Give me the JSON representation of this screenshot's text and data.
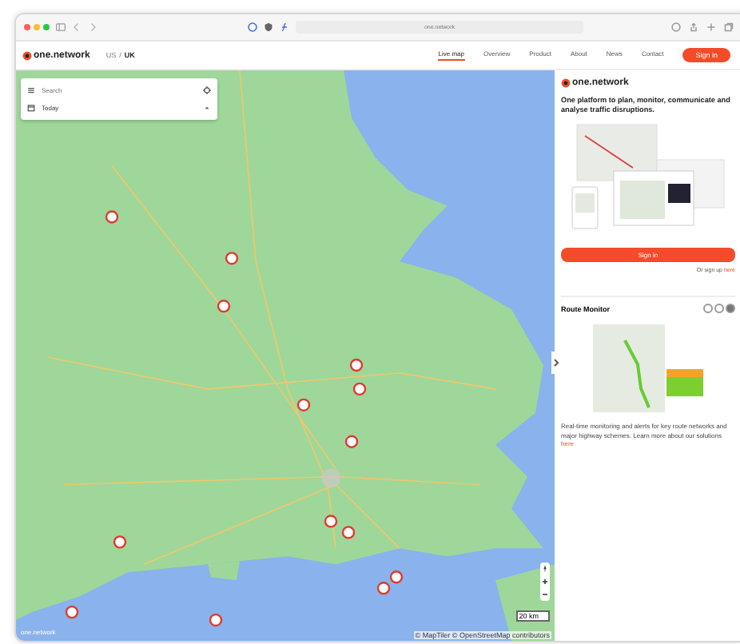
{
  "browser": {
    "url": "one.network"
  },
  "site": {
    "logo": "one.network",
    "region": {
      "options": [
        {
          "label": "US",
          "selected": false
        },
        {
          "label": "UK",
          "selected": true
        }
      ],
      "separator": "/"
    },
    "nav": [
      {
        "label": "Live map",
        "selected": true
      },
      {
        "label": "Overview",
        "selected": false
      },
      {
        "label": "Product",
        "selected": false
      },
      {
        "label": "About",
        "selected": false
      },
      {
        "label": "News",
        "selected": false
      },
      {
        "label": "Contact",
        "selected": false
      }
    ],
    "sign_in": "Sign in"
  },
  "map_panel": {
    "search": {
      "placeholder": "Search"
    },
    "date": "Today",
    "watermark": "one.network",
    "attribution": "© MapTiler © OpenStreetMap contributors",
    "scale": "20 km"
  },
  "sidebar": {
    "logo": "one.network",
    "headline": "One platform to plan, monitor, communicate and analyse traffic disruptions.",
    "sign_in": "Sign in",
    "signup_text": "Or sign up",
    "signup_link": "here",
    "section_title": "Route Monitor",
    "carousel": [
      {
        "selected": false
      },
      {
        "selected": false
      },
      {
        "selected": true
      }
    ],
    "description": "Real-time monitoring and alerts for key route networks and major highway schemes. Learn more about our solutions",
    "description_link": "here"
  }
}
